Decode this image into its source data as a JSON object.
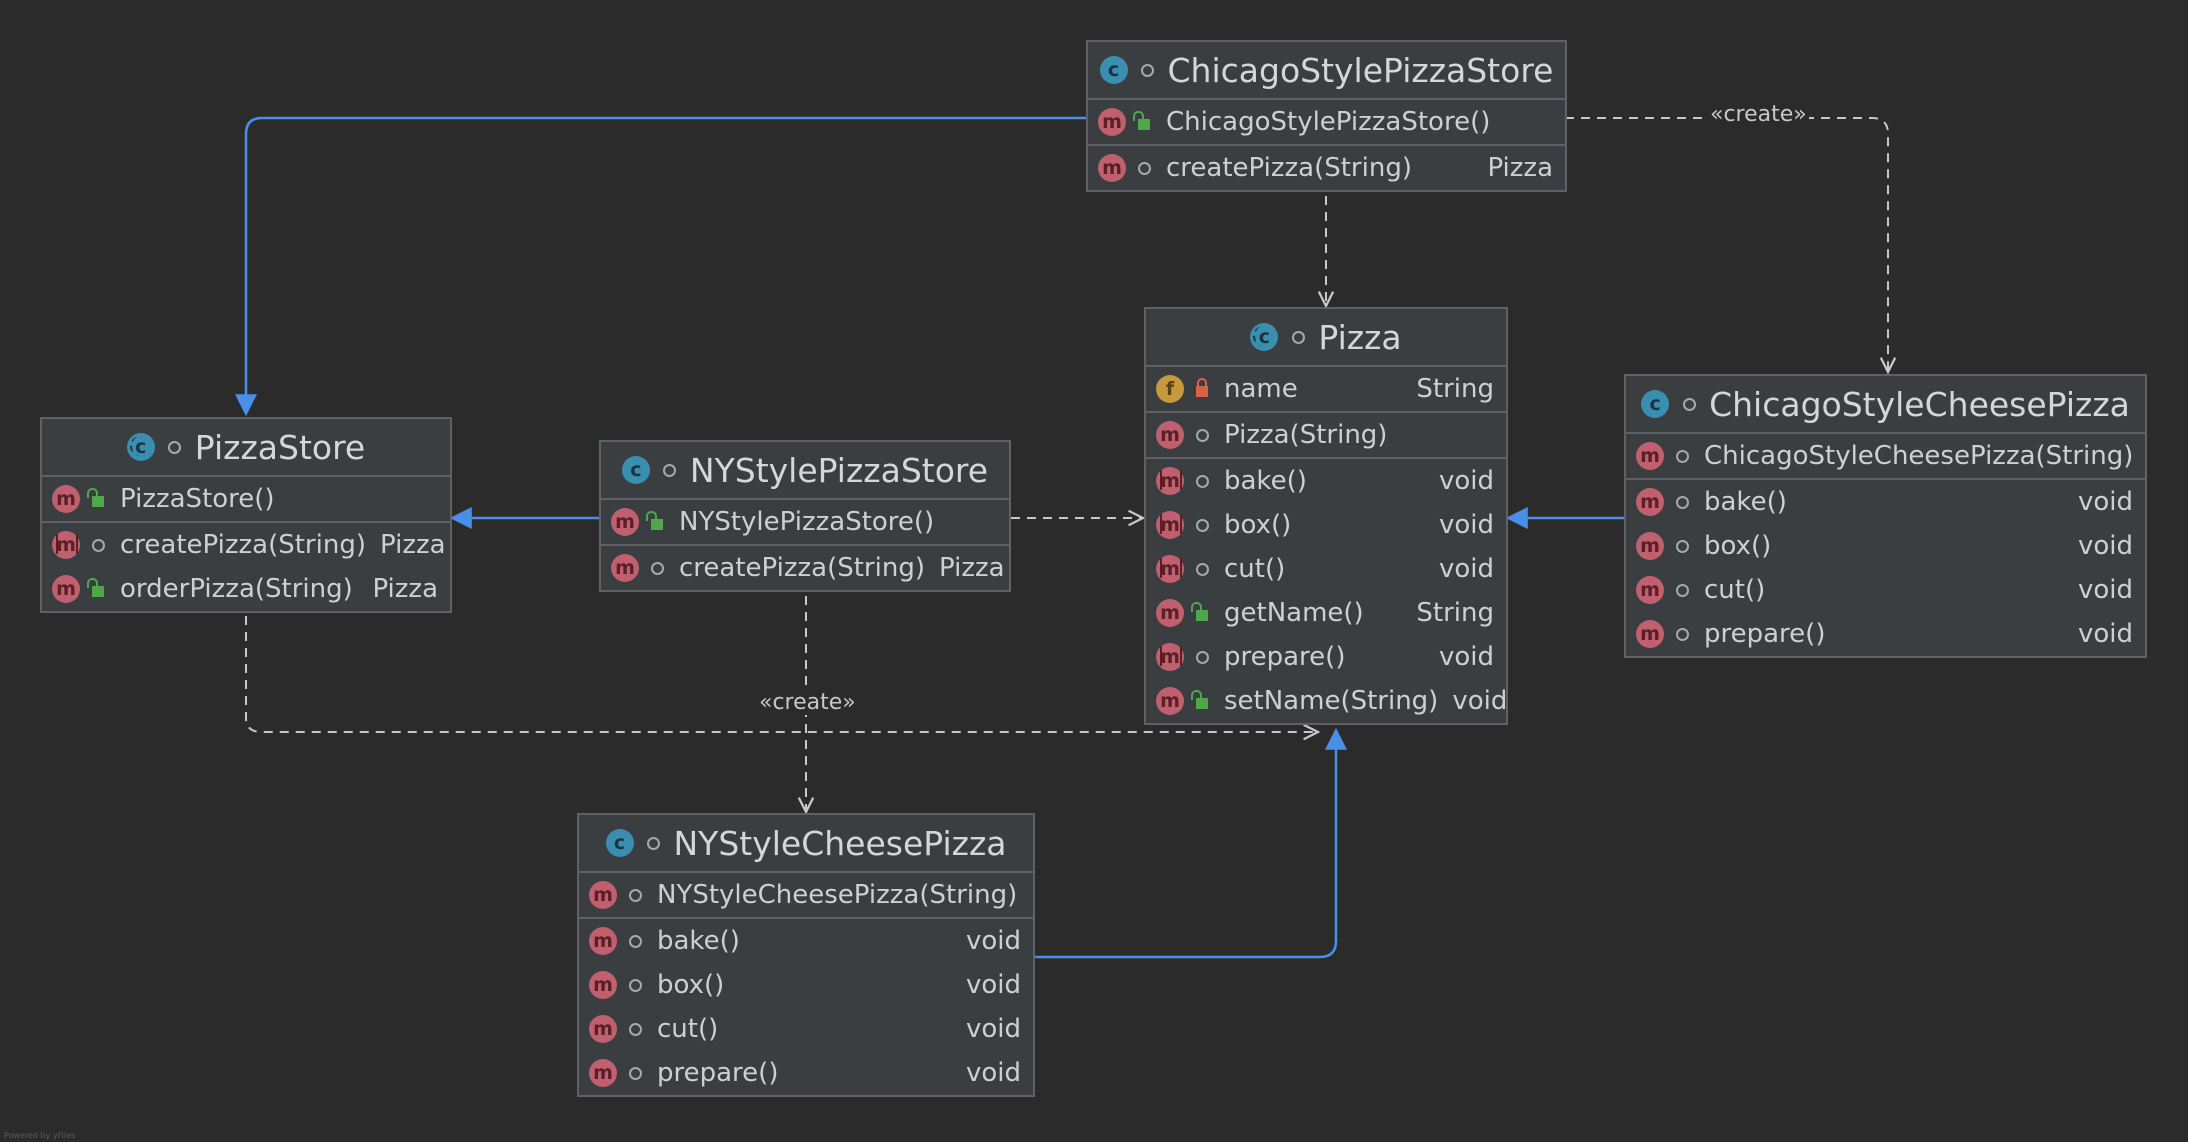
{
  "diagram": {
    "classes": [
      {
        "id": "ChicagoStylePizzaStore",
        "kind": "class",
        "title": "ChicagoStylePizzaStore",
        "sections": [
          [
            {
              "badge": "m",
              "vis": "pub",
              "name": "ChicagoStylePizzaStore()",
              "type": ""
            }
          ],
          [
            {
              "badge": "m",
              "vis": "pkg",
              "name": "createPizza(String)",
              "type": "Pizza"
            }
          ]
        ]
      },
      {
        "id": "Pizza",
        "kind": "abstract",
        "title": "Pizza",
        "sections": [
          [
            {
              "badge": "f",
              "vis": "priv",
              "name": "name",
              "type": "String"
            }
          ],
          [
            {
              "badge": "m",
              "vis": "pkg",
              "name": "Pizza(String)",
              "type": ""
            }
          ],
          [
            {
              "badge": "m-abs",
              "vis": "pkg",
              "name": "bake()",
              "type": "void"
            },
            {
              "badge": "m-abs",
              "vis": "pkg",
              "name": "box()",
              "type": "void"
            },
            {
              "badge": "m-abs",
              "vis": "pkg",
              "name": "cut()",
              "type": "void"
            },
            {
              "badge": "m",
              "vis": "pub",
              "name": "getName()",
              "type": "String"
            },
            {
              "badge": "m-abs",
              "vis": "pkg",
              "name": "prepare()",
              "type": "void"
            },
            {
              "badge": "m",
              "vis": "pub",
              "name": "setName(String)",
              "type": "void"
            }
          ]
        ]
      },
      {
        "id": "ChicagoStyleCheesePizza",
        "kind": "class",
        "title": "ChicagoStyleCheesePizza",
        "sections": [
          [
            {
              "badge": "m",
              "vis": "pkg",
              "name": "ChicagoStyleCheesePizza(String)",
              "type": ""
            }
          ],
          [
            {
              "badge": "m",
              "vis": "pkg",
              "name": "bake()",
              "type": "void"
            },
            {
              "badge": "m",
              "vis": "pkg",
              "name": "box()",
              "type": "void"
            },
            {
              "badge": "m",
              "vis": "pkg",
              "name": "cut()",
              "type": "void"
            },
            {
              "badge": "m",
              "vis": "pkg",
              "name": "prepare()",
              "type": "void"
            }
          ]
        ]
      },
      {
        "id": "PizzaStore",
        "kind": "abstract",
        "title": "PizzaStore",
        "sections": [
          [
            {
              "badge": "m",
              "vis": "pub",
              "name": "PizzaStore()",
              "type": ""
            }
          ],
          [
            {
              "badge": "m-abs",
              "vis": "pkg",
              "name": "createPizza(String)",
              "type": "Pizza"
            },
            {
              "badge": "m",
              "vis": "pub",
              "name": "orderPizza(String)",
              "type": "Pizza"
            }
          ]
        ]
      },
      {
        "id": "NYStylePizzaStore",
        "kind": "class",
        "title": "NYStylePizzaStore",
        "sections": [
          [
            {
              "badge": "m",
              "vis": "pub",
              "name": "NYStylePizzaStore()",
              "type": ""
            }
          ],
          [
            {
              "badge": "m",
              "vis": "pkg",
              "name": "createPizza(String)",
              "type": "Pizza"
            }
          ]
        ]
      },
      {
        "id": "NYStyleCheesePizza",
        "kind": "class",
        "title": "NYStyleCheesePizza",
        "sections": [
          [
            {
              "badge": "m",
              "vis": "pkg",
              "name": "NYStyleCheesePizza(String)",
              "type": ""
            }
          ],
          [
            {
              "badge": "m",
              "vis": "pkg",
              "name": "bake()",
              "type": "void"
            },
            {
              "badge": "m",
              "vis": "pkg",
              "name": "box()",
              "type": "void"
            },
            {
              "badge": "m",
              "vis": "pkg",
              "name": "cut()",
              "type": "void"
            },
            {
              "badge": "m",
              "vis": "pkg",
              "name": "prepare()",
              "type": "void"
            }
          ]
        ]
      }
    ],
    "relations": [
      {
        "from": "ChicagoStylePizzaStore",
        "to": "PizzaStore",
        "kind": "extends"
      },
      {
        "from": "NYStylePizzaStore",
        "to": "PizzaStore",
        "kind": "extends"
      },
      {
        "from": "ChicagoStyleCheesePizza",
        "to": "Pizza",
        "kind": "extends"
      },
      {
        "from": "NYStyleCheesePizza",
        "to": "Pizza",
        "kind": "extends"
      },
      {
        "from": "ChicagoStylePizzaStore",
        "to": "Pizza",
        "kind": "uses"
      },
      {
        "from": "NYStylePizzaStore",
        "to": "Pizza",
        "kind": "uses"
      },
      {
        "from": "PizzaStore",
        "to": "Pizza",
        "kind": "uses"
      },
      {
        "from": "ChicagoStylePizzaStore",
        "to": "ChicagoStyleCheesePizza",
        "kind": "create",
        "label": "«create»"
      },
      {
        "from": "NYStylePizzaStore",
        "to": "NYStyleCheesePizza",
        "kind": "create",
        "label": "«create»"
      }
    ],
    "colors": {
      "background": "#2b2b2b",
      "node_fill": "#3b3e41",
      "node_border": "#5e6266",
      "inheritance": "#4a8fe7",
      "dependency": "#c8c8c8"
    }
  },
  "footer": "Powered by yFiles"
}
